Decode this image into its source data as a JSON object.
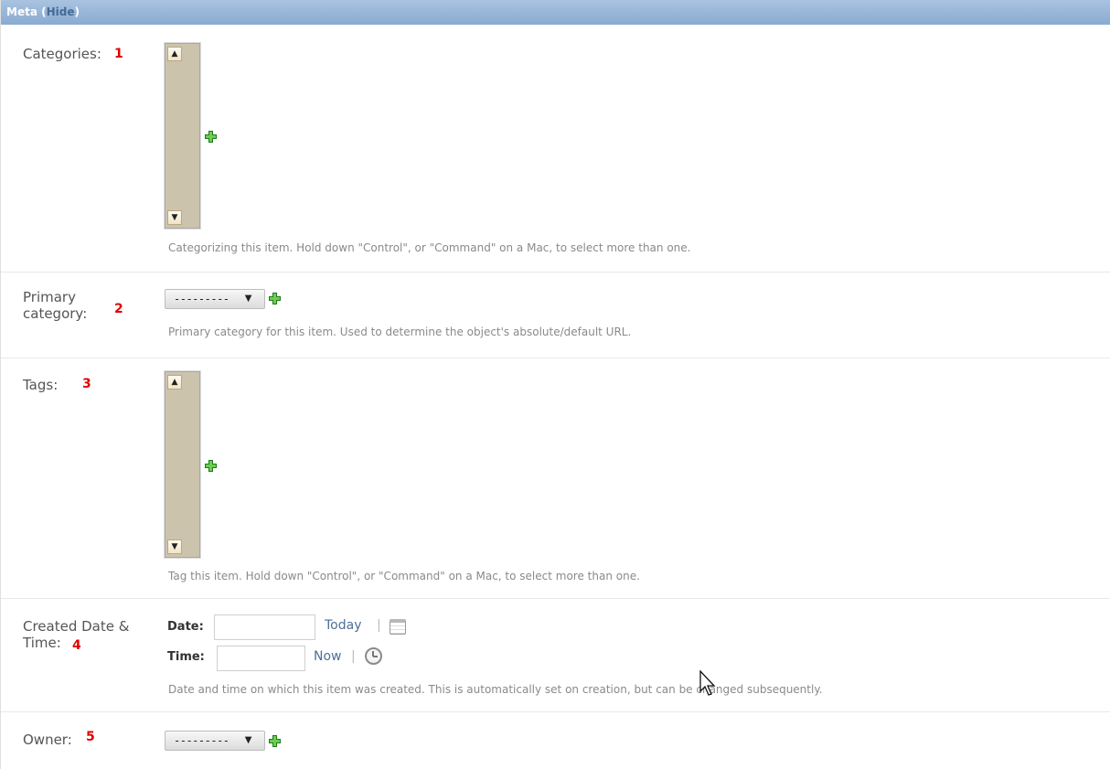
{
  "fieldset": {
    "title": "Meta",
    "toggle_label": "Hide"
  },
  "fields": {
    "categories": {
      "label": "Categories:",
      "number": "1",
      "help": "Categorizing this item. Hold down \"Control\", or \"Command\" on a Mac, to select more than one."
    },
    "primary_category": {
      "label_line1": "Primary",
      "label_line2": "category:",
      "number": "2",
      "selected": "---------",
      "help": "Primary category for this item. Used to determine the object's absolute/default URL."
    },
    "tags": {
      "label": "Tags:",
      "number": "3",
      "help": "Tag this item. Hold down \"Control\", or \"Command\" on a Mac, to select more than one."
    },
    "created": {
      "label_line1": "Created Date &",
      "label_line2": "Time:",
      "number": "4",
      "date_label": "Date:",
      "date_value": "",
      "today_label": "Today",
      "time_label": "Time:",
      "time_value": "",
      "now_label": "Now",
      "separator": "|",
      "help": "Date and time on which this item was created. This is automatically set on creation, but can be changed subsequently."
    },
    "owner": {
      "label": "Owner:",
      "number": "5",
      "selected": "---------"
    }
  },
  "icons": {
    "add": "plus-icon",
    "calendar": "calendar-icon",
    "clock": "clock-icon",
    "scroll_up": "▲",
    "scroll_down": "▼",
    "dropdown": "▼"
  },
  "colors": {
    "header_bg": "#9ab7dc",
    "number_red": "#e00000",
    "link_blue": "#4d6f9a",
    "add_green": "#2e9e2e"
  }
}
